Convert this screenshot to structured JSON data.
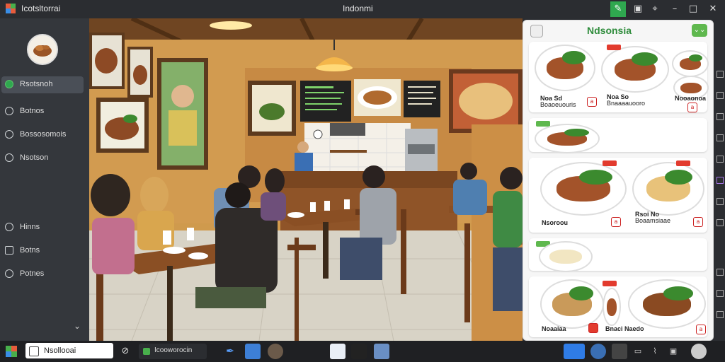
{
  "window": {
    "app_name": "Icotsltorrai",
    "title": "Indonmi"
  },
  "sidebar": {
    "items": [
      {
        "label": "Rsotsnoh",
        "icon": "check-icon",
        "active": true
      },
      {
        "label": "Botnos",
        "icon": "circle-icon"
      },
      {
        "label": "Bossosomois",
        "icon": "circle-icon"
      },
      {
        "label": "Nsotson",
        "icon": "circle-icon"
      },
      {
        "label": "Hinns",
        "icon": "circle-icon"
      },
      {
        "label": "Botns",
        "icon": "grid-icon"
      },
      {
        "label": "Potnes",
        "icon": "pin-icon"
      }
    ]
  },
  "panel": {
    "title": "Ndsonsia",
    "cards": [
      {
        "captions": [
          {
            "bold": "Noa Sd",
            "sub": "Boaoeuouris"
          },
          {
            "bold": "Noa So",
            "sub": "Bnaaaauooro"
          },
          {
            "bold": "",
            "sub": "Nooaonoa"
          }
        ]
      },
      {
        "captions": []
      },
      {
        "captions": [
          {
            "bold": "Nsoroou",
            "sub": ""
          },
          {
            "bold": "Rsoi No",
            "sub": "Boaamsiaae"
          }
        ]
      },
      {
        "captions": []
      },
      {
        "captions": [
          {
            "bold": "Noaaiaa",
            "sub": ""
          },
          {
            "bold": "Bnaci Naedo",
            "sub": ""
          }
        ]
      }
    ]
  },
  "taskbar": {
    "search_label": "Nsollooai",
    "app_label": "Icooworocin"
  }
}
